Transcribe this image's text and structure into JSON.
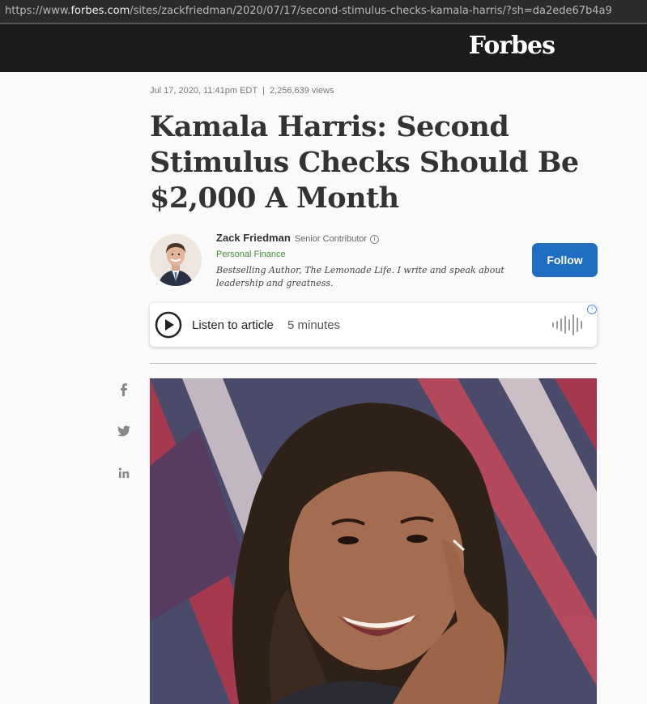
{
  "browser": {
    "url_prefix": "https://www.",
    "url_domain": "forbes.com",
    "url_path": "/sites/zackfriedman/2020/07/17/second-stimulus-checks-kamala-harris/?sh=da2ede67b4a9"
  },
  "masthead": {
    "logo": "Forbes",
    "background": "#1b1b1b"
  },
  "article": {
    "date": "Jul 17, 2020, 11:41pm EDT",
    "separator": "|",
    "views": "2,256,639 views",
    "headline": "Kamala Harris: Second Stimulus Checks Should Be $2,000 A Month"
  },
  "author": {
    "name": "Zack Friedman",
    "role": "Senior Contributor",
    "info_icon": "i",
    "topic": "Personal Finance",
    "bio": "Bestselling Author, The Lemonade Life. I write and speak about leadership and greatness.",
    "follow_label": "Follow",
    "follow_color": "#1f6ec4"
  },
  "player": {
    "label": "Listen to article",
    "duration": "5 minutes",
    "play_icon": "play-icon",
    "wave_icon": "audio-wave-icon",
    "ad_icon": "i"
  },
  "share": {
    "icons": [
      "facebook-icon",
      "twitter-icon",
      "linkedin-icon"
    ]
  }
}
